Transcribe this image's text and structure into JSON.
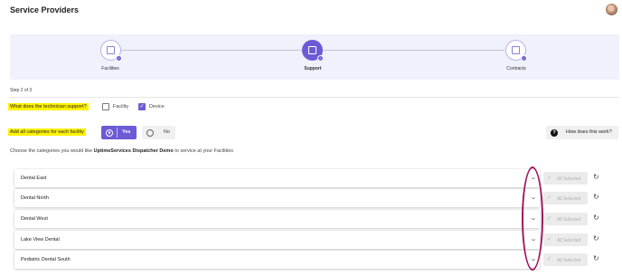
{
  "header": {
    "title": "Service Providers",
    "avatar_icon": "user-avatar"
  },
  "stepper": {
    "steps": [
      {
        "label": "Facilities",
        "icon": "building-icon",
        "state": "complete"
      },
      {
        "label": "Support",
        "icon": "gear-icon",
        "state": "active"
      },
      {
        "label": "Contracts",
        "icon": "document-icon",
        "state": "complete"
      }
    ],
    "step_count": "Step 2 of 3"
  },
  "support_question": {
    "label": "What does the technician support?",
    "options": [
      {
        "label": "Facility",
        "checked": false
      },
      {
        "label": "Device",
        "checked": true
      }
    ]
  },
  "categories_question": {
    "label": "Add all categories for each facility",
    "yes_label": "Yes",
    "no_label": "No",
    "selected": "Yes"
  },
  "help": {
    "label": "How does this work?",
    "icon": "question-circle-icon"
  },
  "instructions": {
    "prefix": "Choose the categories you would like ",
    "org": "UptimeServices Dispatcher Demo",
    "suffix": " to service at your Facilities"
  },
  "facilities": [
    {
      "name": "Dental East",
      "status": "All Selected"
    },
    {
      "name": "Dental North",
      "status": "All Selected"
    },
    {
      "name": "Dental West",
      "status": "All Selected"
    },
    {
      "name": "Lake View Dental",
      "status": "All Selected"
    },
    {
      "name": "Pediatric Dental South",
      "status": "All Selected"
    }
  ],
  "colors": {
    "accent": "#6c5bd6",
    "highlight": "#fff200",
    "annotation": "#a0165e"
  }
}
